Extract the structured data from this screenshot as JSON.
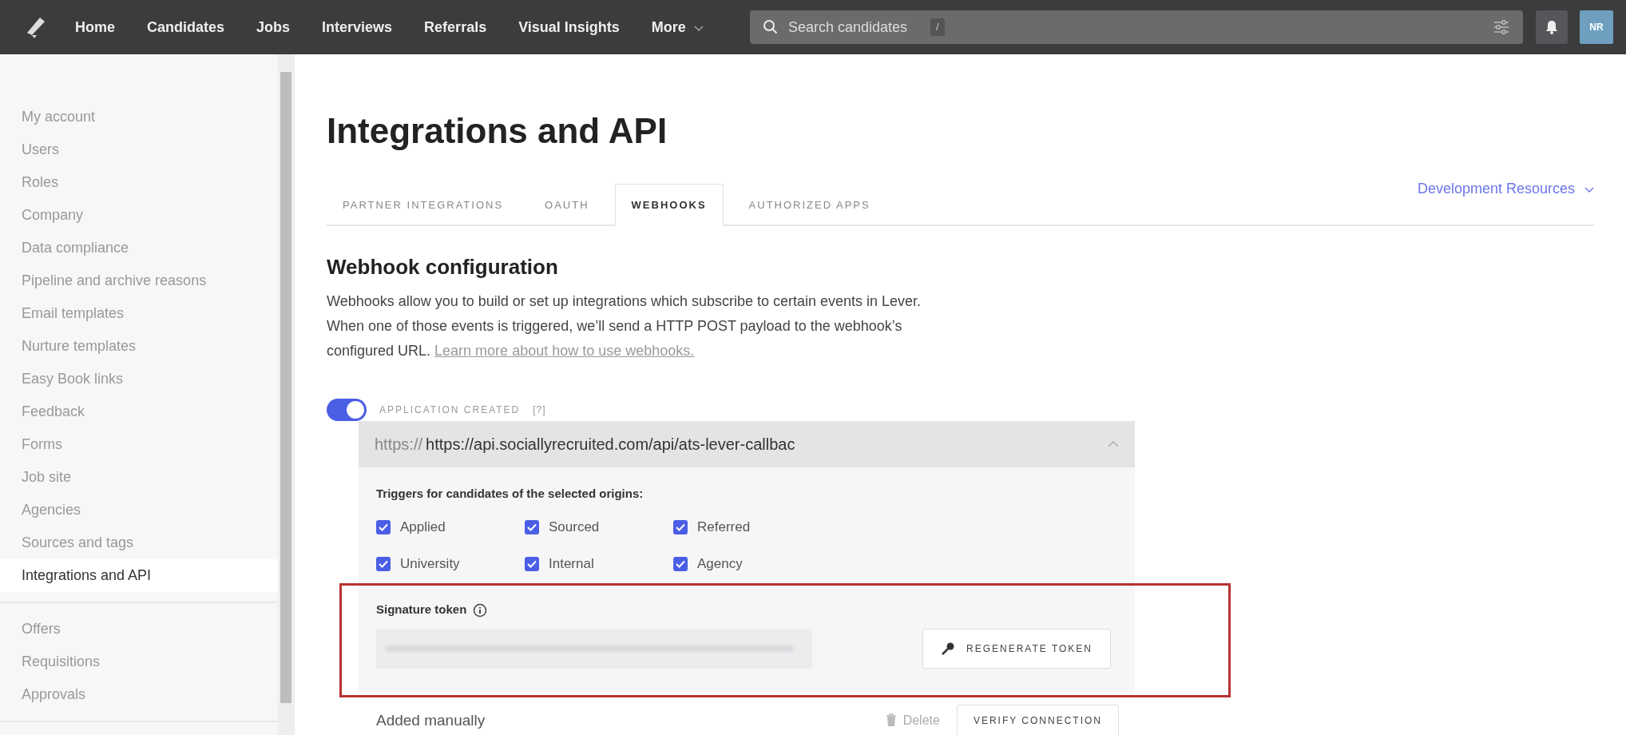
{
  "topnav": {
    "items": [
      {
        "label": "Home"
      },
      {
        "label": "Candidates"
      },
      {
        "label": "Jobs"
      },
      {
        "label": "Interviews"
      },
      {
        "label": "Referrals"
      },
      {
        "label": "Visual Insights"
      },
      {
        "label": "More",
        "dropdown": true
      }
    ],
    "search": {
      "placeholder": "Search candidates",
      "shortcut": "/"
    },
    "avatar": "NR"
  },
  "sidebar": {
    "groups": [
      [
        {
          "label": "My account",
          "selected": false
        },
        {
          "label": "Users",
          "selected": false
        },
        {
          "label": "Roles",
          "selected": false
        },
        {
          "label": "Company",
          "selected": false
        },
        {
          "label": "Data compliance",
          "selected": false
        },
        {
          "label": "Pipeline and archive reasons",
          "selected": false
        },
        {
          "label": "Email templates",
          "selected": false
        },
        {
          "label": "Nurture templates",
          "selected": false
        },
        {
          "label": "Easy Book links",
          "selected": false
        },
        {
          "label": "Feedback",
          "selected": false
        },
        {
          "label": "Forms",
          "selected": false
        },
        {
          "label": "Job site",
          "selected": false
        },
        {
          "label": "Agencies",
          "selected": false
        },
        {
          "label": "Sources and tags",
          "selected": false
        },
        {
          "label": "Integrations and API",
          "selected": true
        }
      ],
      [
        {
          "label": "Offers",
          "selected": false
        },
        {
          "label": "Requisitions",
          "selected": false
        },
        {
          "label": "Approvals",
          "selected": false
        }
      ]
    ]
  },
  "page": {
    "title": "Integrations and API",
    "tabs": [
      {
        "label": "PARTNER INTEGRATIONS",
        "selected": false
      },
      {
        "label": "OAUTH",
        "selected": false
      },
      {
        "label": "WEBHOOKS",
        "selected": true
      },
      {
        "label": "AUTHORIZED APPS",
        "selected": false
      }
    ],
    "resources_link": "Development Resources",
    "section_title": "Webhook configuration",
    "description": "Webhooks allow you to build or set up integrations which subscribe to certain events in Lever. When one of those events is triggered, we’ll send a HTTP POST payload to the webhook’s configured URL.",
    "learn_more": "Learn more about how to use webhooks.",
    "webhook": {
      "on": true,
      "event": "APPLICATION CREATED",
      "help": "[?]",
      "url_prefix": "https://",
      "url": "https://api.sociallyrecruited.com/api/ats-lever-callbac",
      "expanded": true,
      "triggers_label": "Triggers for candidates of the selected origins:",
      "origins": [
        {
          "label": "Applied",
          "checked": true
        },
        {
          "label": "Sourced",
          "checked": true
        },
        {
          "label": "Referred",
          "checked": true
        },
        {
          "label": "University",
          "checked": true
        },
        {
          "label": "Internal",
          "checked": true
        },
        {
          "label": "Agency",
          "checked": true
        }
      ],
      "token_label": "Signature token",
      "regenerate": "REGENERATE TOKEN",
      "source": "Added manually",
      "delete": "Delete",
      "verify": "VERIFY CONNECTION"
    }
  }
}
